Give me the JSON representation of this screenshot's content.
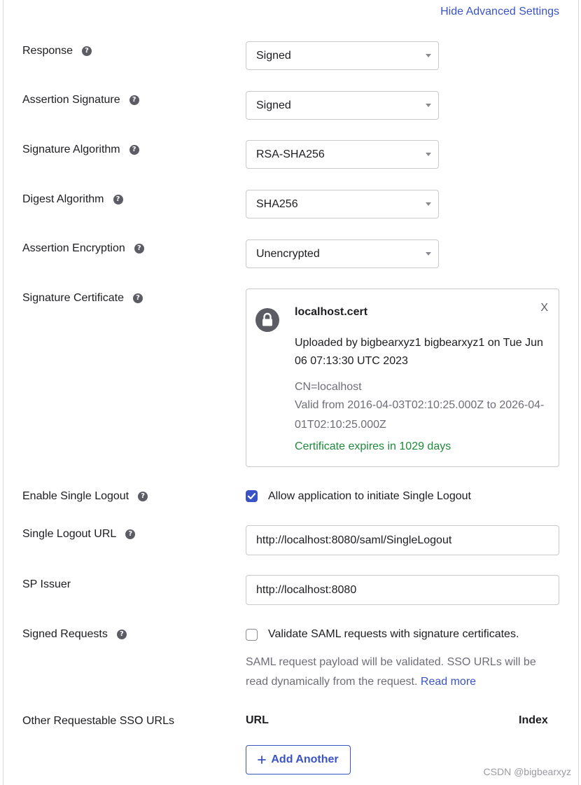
{
  "advanced_link": "Hide Advanced Settings",
  "fields": {
    "response": {
      "label": "Response",
      "value": "Signed"
    },
    "assertion_signature": {
      "label": "Assertion Signature",
      "value": "Signed"
    },
    "signature_algorithm": {
      "label": "Signature Algorithm",
      "value": "RSA-SHA256"
    },
    "digest_algorithm": {
      "label": "Digest Algorithm",
      "value": "SHA256"
    },
    "assertion_encryption": {
      "label": "Assertion Encryption",
      "value": "Unencrypted"
    },
    "signature_certificate": {
      "label": "Signature Certificate"
    },
    "enable_single_logout": {
      "label": "Enable Single Logout",
      "checkbox_label": "Allow application to initiate Single Logout",
      "checked": true
    },
    "single_logout_url": {
      "label": "Single Logout URL",
      "value": "http://localhost:8080/saml/SingleLogout"
    },
    "sp_issuer": {
      "label": "SP Issuer",
      "value": "http://localhost:8080"
    },
    "signed_requests": {
      "label": "Signed Requests",
      "checkbox_label": "Validate SAML requests with signature certificates.",
      "checked": false,
      "help_text": "SAML request payload will be validated. SSO URLs will be read dynamically from the request.",
      "read_more": "Read more"
    },
    "other_sso_urls": {
      "label": "Other Requestable SSO URLs",
      "col_url": "URL",
      "col_index": "Index",
      "add_label": "Add Another"
    }
  },
  "certificate": {
    "name": "localhost.cert",
    "uploaded": "Uploaded by bigbearxyz1 bigbearxyz1 on Tue Jun 06 07:13:30 UTC 2023",
    "cn": "CN=localhost",
    "valid": "Valid from 2016-04-03T02:10:25.000Z to 2026-04-01T02:10:25.000Z",
    "expires": "Certificate expires in 1029 days",
    "close": "X"
  },
  "help_glyph": "?",
  "watermark": "CSDN @bigbearxyz",
  "colors": {
    "accent": "#3a53c5",
    "success": "#1e8a3a",
    "muted": "#6e6e78"
  }
}
